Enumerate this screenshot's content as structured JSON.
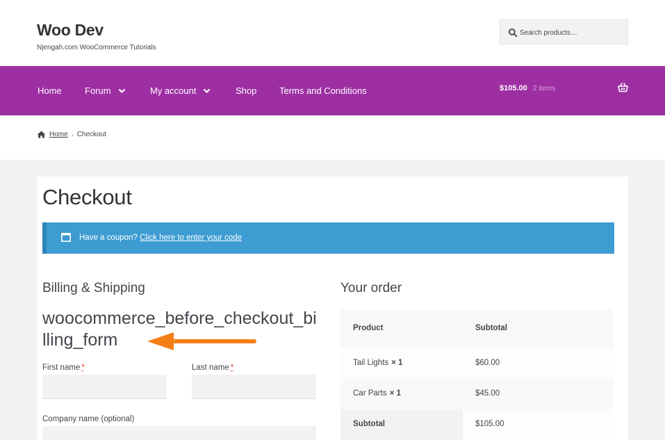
{
  "header": {
    "site_title": "Woo Dev",
    "tagline": "Njengah.com WooCommerce Tutorials",
    "search_placeholder": "Search products…"
  },
  "nav": {
    "items": [
      {
        "label": "Home",
        "has_dropdown": false
      },
      {
        "label": "Forum",
        "has_dropdown": true
      },
      {
        "label": "My account",
        "has_dropdown": true
      },
      {
        "label": "Shop",
        "has_dropdown": false
      },
      {
        "label": "Terms and Conditions",
        "has_dropdown": false
      }
    ],
    "cart_total": "$105.00",
    "cart_count": "2 items",
    "color": "#9d2fa3"
  },
  "breadcrumb": {
    "home": "Home",
    "separator": "›",
    "current": "Checkout"
  },
  "page": {
    "title": "Checkout"
  },
  "coupon": {
    "prompt": "Have a coupon?",
    "link": "Click here to enter your code",
    "color": "#3d9cd2"
  },
  "billing": {
    "heading": "Billing & Shipping",
    "hook_text": "woocommerce_before_checkout_billing_form",
    "fields": {
      "first_name": {
        "label": "First name",
        "required": "*",
        "value": ""
      },
      "last_name": {
        "label": "Last name",
        "required": "*",
        "value": ""
      },
      "company": {
        "label": "Company name (optional)",
        "value": ""
      }
    }
  },
  "order": {
    "heading": "Your order",
    "columns": [
      "Product",
      "Subtotal"
    ],
    "items": [
      {
        "name": "Tail Lights",
        "qty": "× 1",
        "subtotal": "$60.00"
      },
      {
        "name": "Car Parts",
        "qty": "× 1",
        "subtotal": "$45.00"
      }
    ],
    "subtotal_label": "Subtotal",
    "subtotal_value": "$105.00"
  },
  "annotation": {
    "arrow_color": "#f57f17"
  }
}
